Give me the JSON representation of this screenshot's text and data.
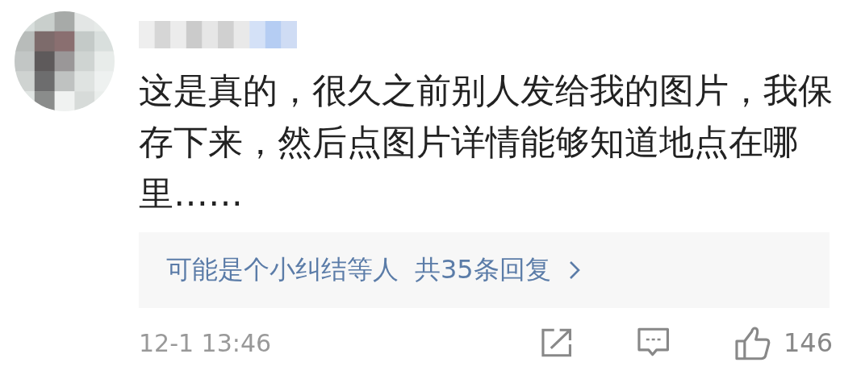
{
  "comment": {
    "text": "这是真的，很久之前别人发给我的图片，我保存下来，然后点图片详情能够知道地点在哪里……"
  },
  "replies": {
    "names": "可能是个小纠结等人",
    "count": "共35条回复"
  },
  "footer": {
    "time": "12-1 13:46",
    "likes": "146"
  }
}
